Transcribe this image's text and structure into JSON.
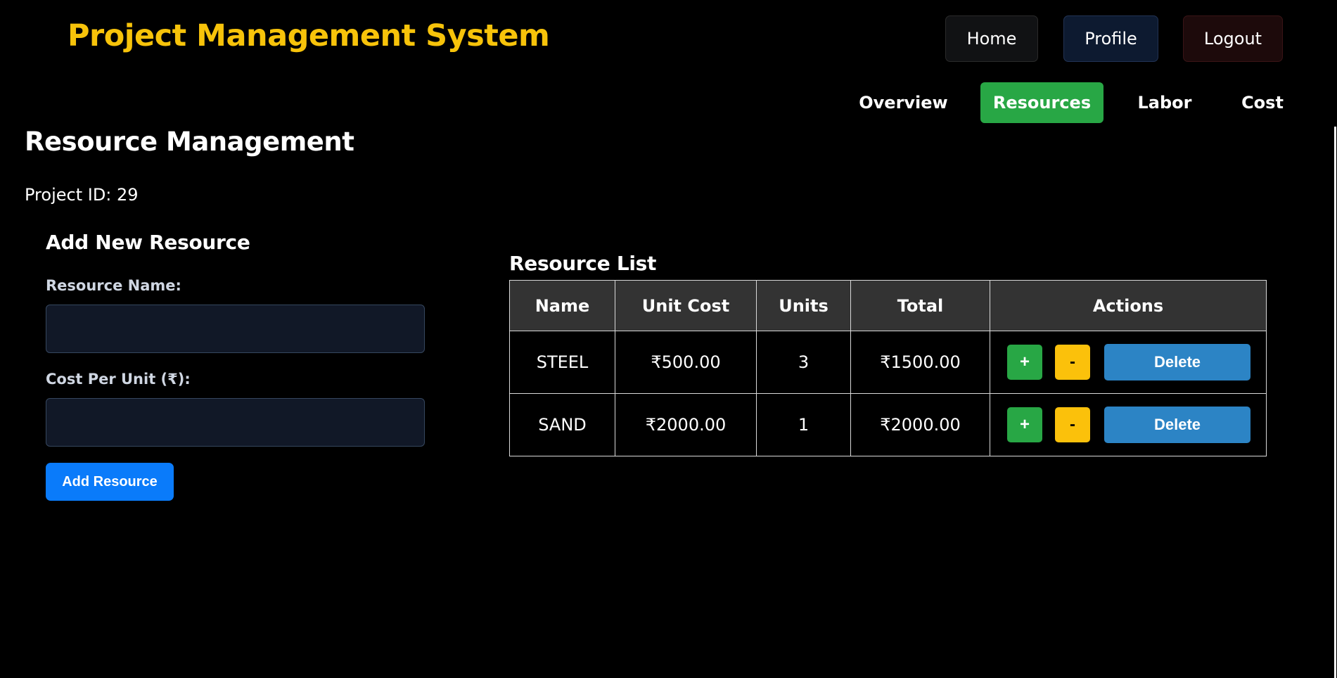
{
  "header": {
    "title": "Project Management System",
    "nav": {
      "home": "Home",
      "profile": "Profile",
      "logout": "Logout"
    }
  },
  "tabs": {
    "overview": "Overview",
    "resources": "Resources",
    "labor": "Labor",
    "cost": "Cost",
    "active": "Resources"
  },
  "page": {
    "title": "Resource Management",
    "project_id": "Project ID: 29"
  },
  "add_form": {
    "title": "Add New Resource",
    "name_label": "Resource Name:",
    "name_value": "",
    "cost_label": "Cost Per Unit (₹):",
    "cost_value": "",
    "submit": "Add Resource"
  },
  "resource_list": {
    "title": "Resource List",
    "columns": [
      "Name",
      "Unit Cost",
      "Units",
      "Total",
      "Actions"
    ],
    "rows": [
      {
        "name": "STEEL",
        "unit_cost": "₹500.00",
        "units": "3",
        "total": "₹1500.00"
      },
      {
        "name": "SAND",
        "unit_cost": "₹2000.00",
        "units": "1",
        "total": "₹2000.00"
      }
    ],
    "actions": {
      "plus": "+",
      "minus": "-",
      "delete": "Delete"
    }
  },
  "colors": {
    "brand": "#f7c30a",
    "active_tab": "#28a745",
    "primary": "#0a7bfa",
    "delete": "#2c84c5",
    "minus": "#fbc10b"
  }
}
